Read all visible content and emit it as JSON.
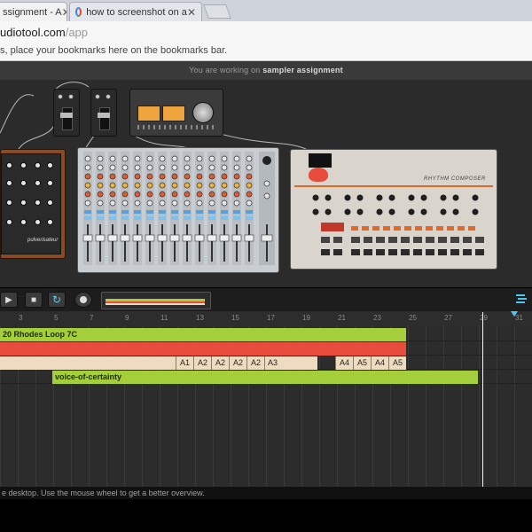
{
  "browser": {
    "tabs": [
      {
        "title": "ssignment - A",
        "close": "✕"
      },
      {
        "title": "how to screenshot on a",
        "close": "✕"
      }
    ],
    "url_host": "udiotool.com",
    "url_path": "/app",
    "bookmarks_hint": "s, place your bookmarks here on the bookmarks bar."
  },
  "app": {
    "header_prefix": "You are working on",
    "project_name": "sampler assignment",
    "status_text": "e desktop. Use the mouse wheel to get a better overview."
  },
  "devices": {
    "drum_machine_brand": "RHYTHM COMPOSER",
    "left_synth_label": "pulverisateur"
  },
  "timeline": {
    "ruler": [
      "3",
      "5",
      "7",
      "9",
      "11",
      "13",
      "15",
      "17",
      "19",
      "21",
      "23",
      "25",
      "27",
      "29",
      "31"
    ],
    "clips": {
      "rhodes": "20 Rhodes Loop 7C",
      "voice": "voice-of-certainty"
    },
    "patterns_a": [
      "A1",
      "A2",
      "A2",
      "A2",
      "A2",
      "A3"
    ],
    "patterns_b": [
      "A4",
      "A5",
      "A4",
      "A5"
    ]
  },
  "colors": {
    "clip_green": "#a4cf3a",
    "clip_red": "#e74c3c",
    "clip_tan": "#eedcc0",
    "cable": "#c8c8c8"
  }
}
